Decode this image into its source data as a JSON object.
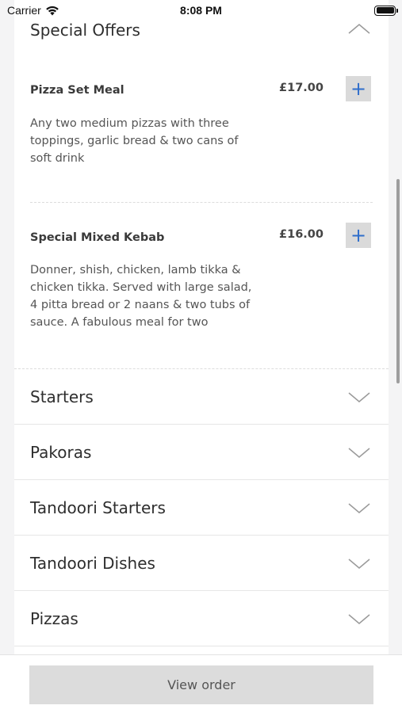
{
  "status_bar": {
    "carrier": "Carrier",
    "time": "8:08 PM"
  },
  "open_section": {
    "title": "Special Offers",
    "items": [
      {
        "name": "Pizza Set Meal",
        "price": "£17.00",
        "description": "Any two medium pizzas with three toppings, garlic bread & two cans of soft drink"
      },
      {
        "name": "Special Mixed Kebab",
        "price": "£16.00",
        "description": "Donner, shish, chicken, lamb tikka & chicken tikka. Served with large salad, 4 pitta bread or 2 naans & two tubs of sauce. A fabulous meal for two"
      }
    ],
    "add_symbol": "+"
  },
  "collapsed_sections": [
    {
      "title": "Starters"
    },
    {
      "title": "Pakoras"
    },
    {
      "title": "Tandoori Starters"
    },
    {
      "title": "Tandoori Dishes"
    },
    {
      "title": "Pizzas"
    }
  ],
  "footer": {
    "view_order_label": "View order"
  },
  "colors": {
    "accent_plus": "#2f6ecb",
    "button_gray": "#dadada"
  }
}
